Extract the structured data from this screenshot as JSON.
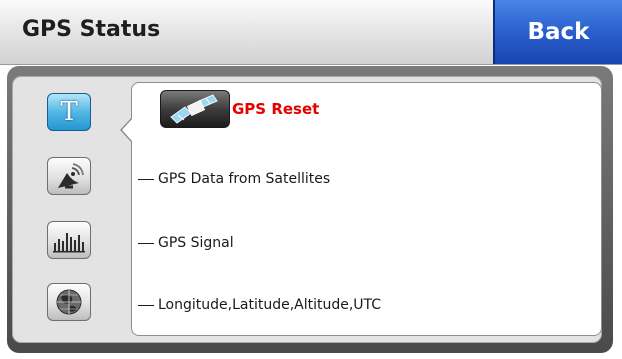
{
  "header": {
    "title": "GPS Status",
    "back_label": "Back"
  },
  "sidebar": {
    "tabs": [
      {
        "name": "text-tab",
        "glyph": "T",
        "icon": "text-icon",
        "active": true
      },
      {
        "name": "satellite-data-tab",
        "icon": "satellite-dish-icon",
        "active": false
      },
      {
        "name": "signal-tab",
        "icon": "signal-bars-icon",
        "active": false
      },
      {
        "name": "globe-tab",
        "icon": "globe-icon",
        "active": false
      }
    ]
  },
  "panel": {
    "reset": {
      "label": "GPS Reset",
      "icon": "satellite-icon"
    },
    "items": [
      {
        "label": "GPS Data from Satellites"
      },
      {
        "label": "GPS Signal"
      },
      {
        "label": "Longitude,Latitude,Altitude,UTC"
      }
    ]
  },
  "colors": {
    "accent_blue": "#2a5fcd",
    "active_tab": "#53b7e4",
    "reset_text": "#e60000"
  }
}
